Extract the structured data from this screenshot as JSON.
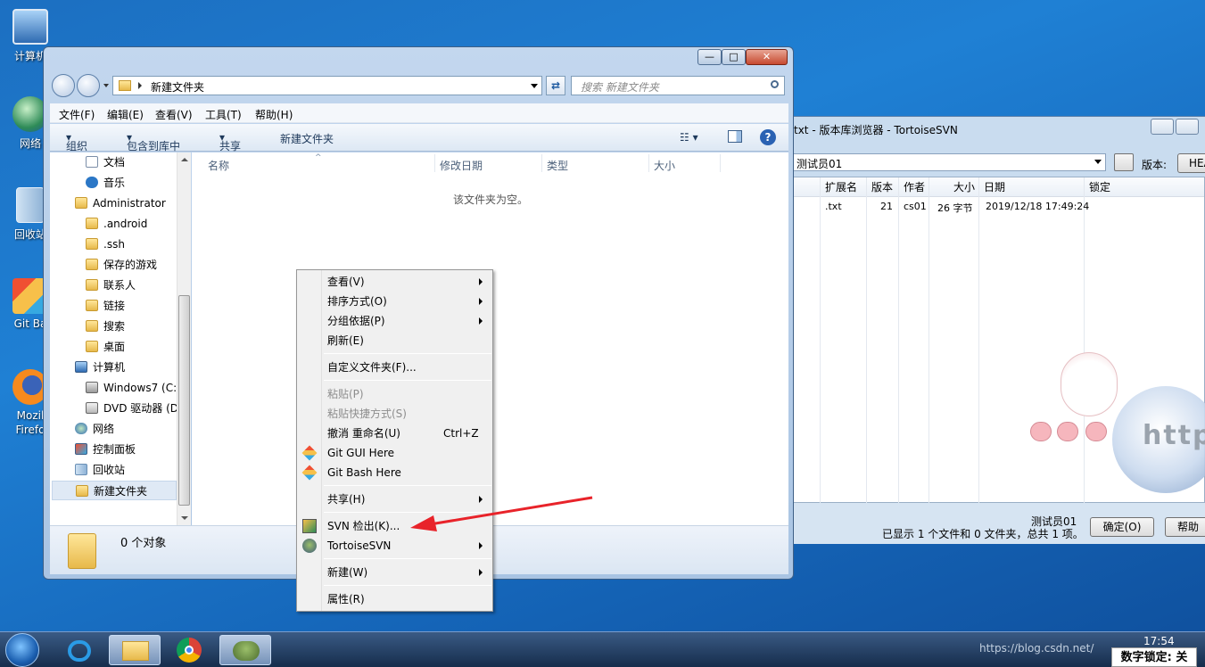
{
  "desktop": {
    "icons": [
      {
        "label": "计算机"
      },
      {
        "label": "网络"
      },
      {
        "label": "回收站"
      },
      {
        "label": "Git Ba"
      },
      {
        "label": "Mozil\nFirefo"
      }
    ]
  },
  "svn_browser": {
    "title": "txt - 版本库浏览器 - TortoiseSVN",
    "url": "测试员01",
    "revision_label": "版本:",
    "revision_value": "HEA",
    "columns": [
      "扩展名",
      "版本",
      "作者",
      "大小",
      "日期",
      "锁定"
    ],
    "rows": [
      {
        "ext": ".txt",
        "rev": "21",
        "author": "cs01",
        "size": "26 字节",
        "date": "2019/12/18 17:49:24",
        "lock": ""
      }
    ],
    "footer_user": "测试员01",
    "footer_status": "已显示 1 个文件和 0 文件夹，总共 1 项。",
    "ok_button": "确定(O)",
    "help_button": "帮助",
    "watermark": "https"
  },
  "explorer": {
    "address": "新建文件夹",
    "search_placeholder": "搜索 新建文件夹",
    "menu": [
      "文件(F)",
      "编辑(E)",
      "查看(V)",
      "工具(T)",
      "帮助(H)"
    ],
    "commands": [
      "组织",
      "包含到库中",
      "共享",
      "新建文件夹"
    ],
    "nav_items": [
      {
        "label": "文档",
        "indent": 2
      },
      {
        "label": "音乐",
        "indent": 2
      },
      {
        "label": "Administrator",
        "indent": 1
      },
      {
        "label": ".android",
        "indent": 2
      },
      {
        "label": ".ssh",
        "indent": 2
      },
      {
        "label": "保存的游戏",
        "indent": 2
      },
      {
        "label": "联系人",
        "indent": 2
      },
      {
        "label": "链接",
        "indent": 2
      },
      {
        "label": "搜索",
        "indent": 2
      },
      {
        "label": "桌面",
        "indent": 2
      },
      {
        "label": "计算机",
        "indent": 1
      },
      {
        "label": "Windows7 (C:",
        "indent": 2
      },
      {
        "label": "DVD 驱动器 (D",
        "indent": 2
      },
      {
        "label": "网络",
        "indent": 1
      },
      {
        "label": "控制面板",
        "indent": 1
      },
      {
        "label": "回收站",
        "indent": 1
      },
      {
        "label": "新建文件夹",
        "indent": 1
      }
    ],
    "columns": [
      "名称",
      "修改日期",
      "类型",
      "大小"
    ],
    "empty_message": "该文件夹为空。",
    "status": "0 个对象"
  },
  "context_menu": {
    "items": [
      {
        "label": "查看(V)",
        "submenu": true
      },
      {
        "label": "排序方式(O)",
        "submenu": true
      },
      {
        "label": "分组依据(P)",
        "submenu": true
      },
      {
        "label": "刷新(E)"
      },
      {
        "sep": true
      },
      {
        "label": "自定义文件夹(F)..."
      },
      {
        "sep": true
      },
      {
        "label": "粘贴(P)",
        "disabled": true
      },
      {
        "label": "粘贴快捷方式(S)",
        "disabled": true
      },
      {
        "label": "撤消 重命名(U)",
        "shortcut": "Ctrl+Z"
      },
      {
        "label": "Git GUI Here",
        "icon": "git-icon"
      },
      {
        "label": "Git Bash Here",
        "icon": "git-icon"
      },
      {
        "sep": true
      },
      {
        "label": "共享(H)",
        "submenu": true
      },
      {
        "sep": true
      },
      {
        "label": "SVN 检出(K)...",
        "icon": "svn-checkout-icon"
      },
      {
        "label": "TortoiseSVN",
        "submenu": true,
        "icon": "tortoise-icon"
      },
      {
        "sep": true
      },
      {
        "label": "新建(W)",
        "submenu": true
      },
      {
        "sep": true
      },
      {
        "label": "属性(R)"
      }
    ]
  },
  "taskbar": {
    "clock": "17:54",
    "numlock": "数字锁定: 关",
    "tray_text": "https://blog.csdn.net/"
  },
  "colors": {
    "desktop": "#1f80d4",
    "annotation_arrow": "#e8232a"
  }
}
